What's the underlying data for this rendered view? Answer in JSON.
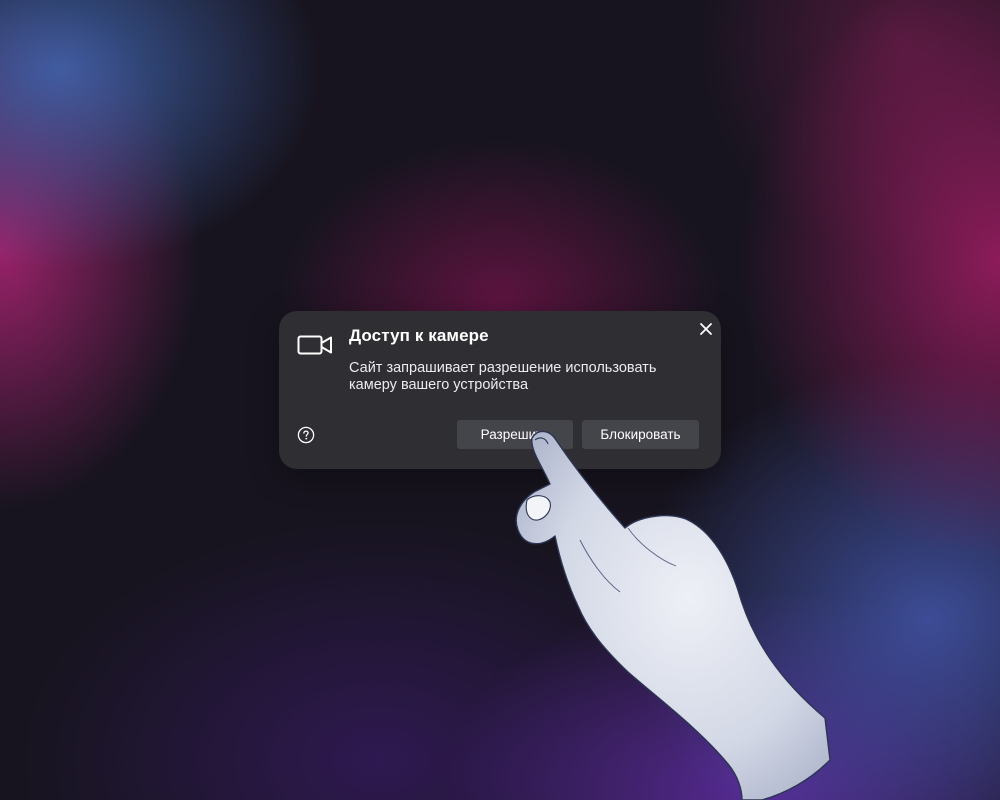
{
  "dialog": {
    "title": "Доступ к камере",
    "description": "Сайт запрашивает разрешение использовать камеру вашего устройства",
    "allow_label": "Разрешить",
    "block_label": "Блокировать",
    "close_icon": "close-icon",
    "help_icon": "question-circle-icon",
    "camera_icon": "video-camera-icon"
  },
  "colors": {
    "dialog_bg": "#2e2e33",
    "button_bg": "#44444b",
    "text": "#ffffff",
    "hand": "#d9dde8",
    "hand_outline": "#2c3552"
  }
}
